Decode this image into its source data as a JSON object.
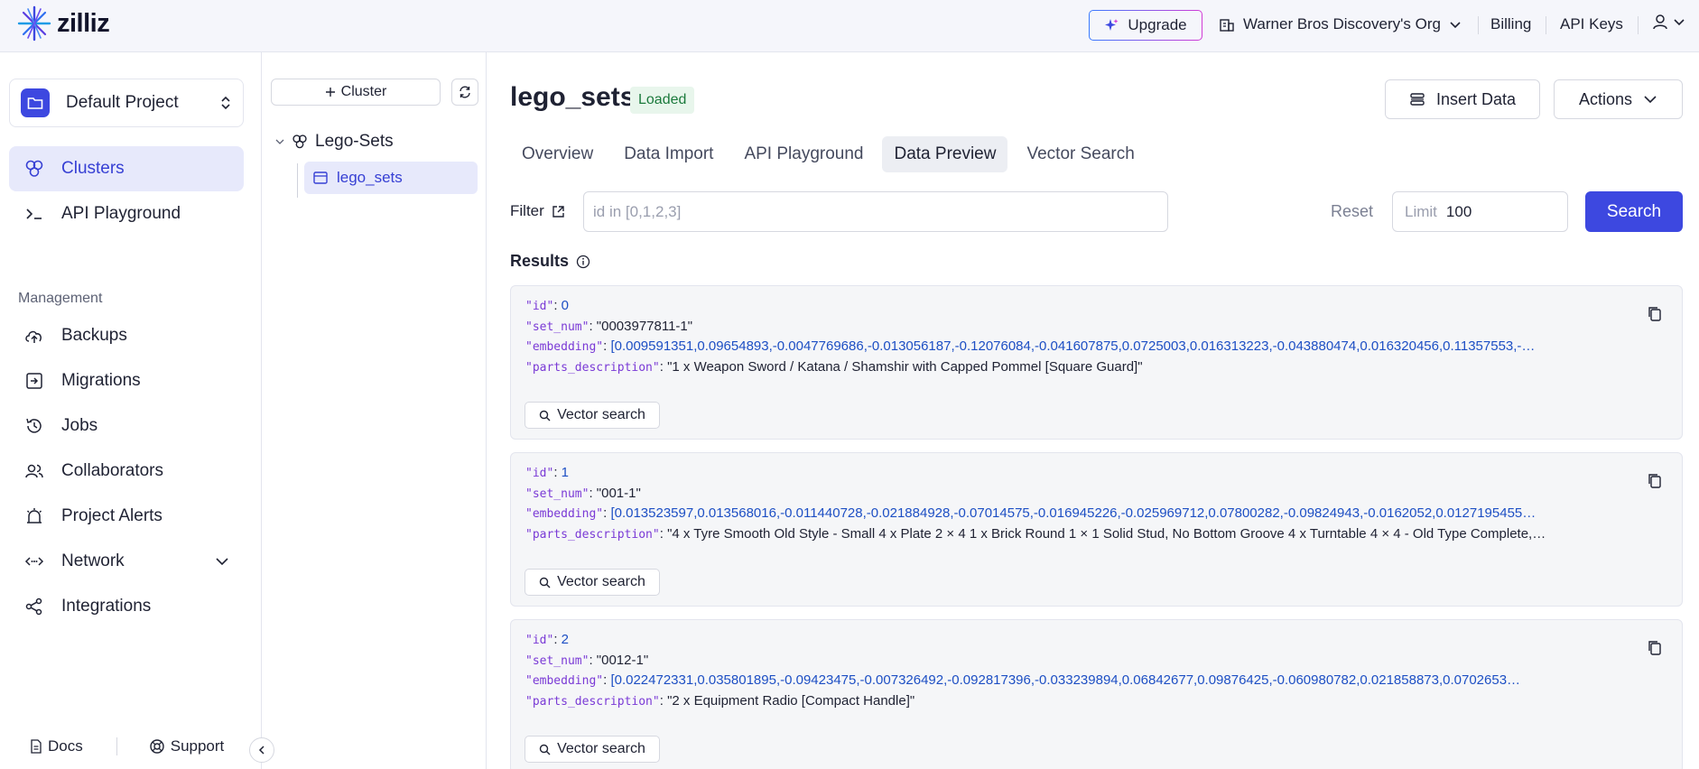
{
  "header": {
    "logo": "zilliz",
    "upgrade": "Upgrade",
    "org": "Warner Bros Discovery's Org",
    "billing": "Billing",
    "api_keys": "API Keys",
    "accent": "#3d48e0"
  },
  "sidebar": {
    "project": "Default Project",
    "items": [
      {
        "label": "Clusters",
        "icon": "clusters-icon",
        "active": true
      },
      {
        "label": "API Playground",
        "icon": "terminal-icon"
      }
    ],
    "management_label": "Management",
    "management": [
      {
        "label": "Backups",
        "icon": "cloud-upload-icon"
      },
      {
        "label": "Migrations",
        "icon": "migrate-icon"
      },
      {
        "label": "Jobs",
        "icon": "history-icon"
      },
      {
        "label": "Collaborators",
        "icon": "users-icon"
      },
      {
        "label": "Project Alerts",
        "icon": "alarm-icon"
      },
      {
        "label": "Network",
        "icon": "network-icon"
      },
      {
        "label": "Integrations",
        "icon": "share-icon"
      }
    ],
    "footer": {
      "docs": "Docs",
      "support": "Support"
    }
  },
  "tree": {
    "add_cluster": "Cluster",
    "cluster": "Lego-Sets",
    "collection": "lego_sets"
  },
  "main": {
    "title": "lego_sets",
    "status": "Loaded",
    "insert_data": "Insert Data",
    "actions": "Actions",
    "tabs": [
      "Overview",
      "Data Import",
      "API Playground",
      "Data Preview",
      "Vector Search"
    ],
    "active_tab": "Data Preview",
    "filter_label": "Filter",
    "filter_placeholder": "id in [0,1,2,3]",
    "reset": "Reset",
    "limit_label": "Limit",
    "limit_value": "100",
    "search": "Search",
    "results_label": "Results",
    "vector_search": "Vector search",
    "keys": {
      "id": "\"id\"",
      "set_num": "\"set_num\"",
      "embedding": "\"embedding\"",
      "parts_description": "\"parts_description\""
    },
    "results": [
      {
        "id": "0",
        "set_num": "\"0003977811-1\"",
        "embedding": "[0.009591351,0.09654893,-0.0047769686,-0.013056187,-0.12076084,-0.041607875,0.0725003,0.016313223,-0.043880474,0.016320456,0.11357553,-…",
        "parts_description": "\"1 x Weapon Sword / Katana / Shamshir with Capped Pommel [Square Guard]\""
      },
      {
        "id": "1",
        "set_num": "\"001-1\"",
        "embedding": "[0.013523597,0.013568016,-0.011440728,-0.021884928,-0.07014575,-0.016945226,-0.025969712,0.07800282,-0.09824943,-0.0162052,0.0127195455…",
        "parts_description": "\"4 x Tyre Smooth Old Style - Small 4 x Plate 2 × 4 1 x Brick Round 1 × 1 Solid Stud, No Bottom Groove 4 x Turntable 4 × 4 - Old Type Complete,…"
      },
      {
        "id": "2",
        "set_num": "\"0012-1\"",
        "embedding": "[0.022472331,0.035801895,-0.09423475,-0.007326492,-0.092817396,-0.033239894,0.06842677,0.09876425,-0.060980782,0.021858873,0.0702653…",
        "parts_description": "\"2 x Equipment Radio [Compact Handle]\""
      }
    ]
  }
}
